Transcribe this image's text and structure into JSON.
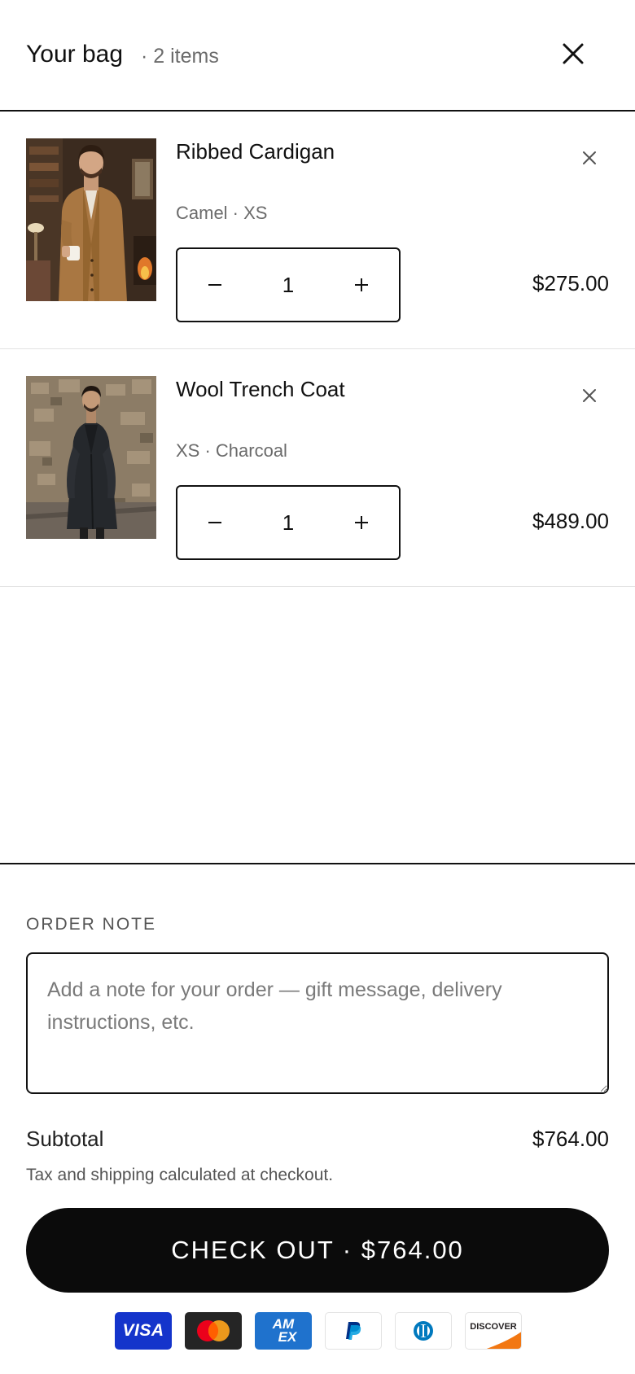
{
  "header": {
    "title": "Your bag",
    "count": "· 2 items"
  },
  "items": [
    {
      "name": "Ribbed Cardigan",
      "variant": "Camel · XS",
      "quantity": "1",
      "price": "$275.00"
    },
    {
      "name": "Wool Trench Coat",
      "variant": "XS · Charcoal",
      "quantity": "1",
      "price": "$489.00"
    }
  ],
  "order_note": {
    "label": "ORDER NOTE",
    "placeholder": "Add a note for your order — gift message, delivery instructions, etc.",
    "value": ""
  },
  "summary": {
    "subtotal_label": "Subtotal",
    "subtotal_value": "$764.00",
    "tax_note": "Tax and shipping calculated at checkout."
  },
  "checkout": {
    "label": "CHECK OUT · $764.00"
  },
  "payment_methods": [
    "visa-icon",
    "mastercard-icon",
    "amex-icon",
    "paypal-icon",
    "diners-club-icon",
    "discover-icon"
  ],
  "payment_labels": {
    "visa": "VISA",
    "amex_top": "AM",
    "amex_bottom": "EX",
    "discover": "DISCOVER"
  },
  "colors": {
    "accent": "#0b0b0b",
    "visa": "#1434cb",
    "mastercard_bg": "#252525",
    "mastercard_red": "#eb001b",
    "mastercard_orange": "#f79e1b",
    "amex": "#1f72cd",
    "paypal_dark": "#003087",
    "paypal_light": "#009cde",
    "diners": "#0079be",
    "discover": "#f27712"
  }
}
